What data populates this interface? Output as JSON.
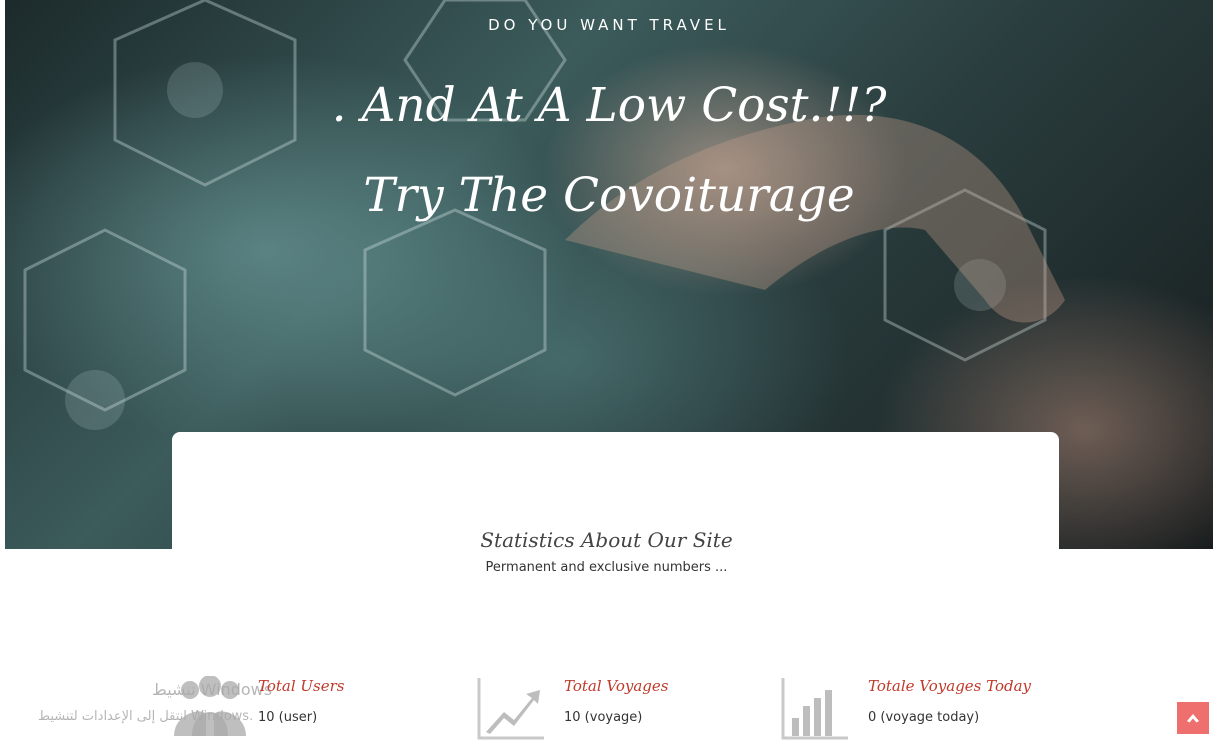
{
  "hero": {
    "kicker": "DO YOU WANT TRAVEL",
    "headline_line1": ". And At A Low Cost.!!?",
    "headline_line2": "Try The Covoiturage"
  },
  "stats_section": {
    "title": "Statistics About Our Site",
    "subtitle": "Permanent and exclusive numbers ..."
  },
  "stats": [
    {
      "icon": "users-icon",
      "title": "Total Users",
      "value": "10 (user)"
    },
    {
      "icon": "trending-up-icon",
      "title": "Total Voyages",
      "value": "10 (voyage)"
    },
    {
      "icon": "bar-chart-icon",
      "title": "Totale Voyages Today",
      "value": "0 (voyage today)"
    }
  ],
  "watermark": {
    "line1": "تنشيط Windows",
    "line2": "انتقل إلى الإعدادات لتنشيط Windows."
  },
  "scroll_top": {
    "icon": "chevron-up-icon",
    "color": "#ef6f6f"
  },
  "colors": {
    "accent": "#c0392b",
    "hero_text": "#ffffff"
  }
}
